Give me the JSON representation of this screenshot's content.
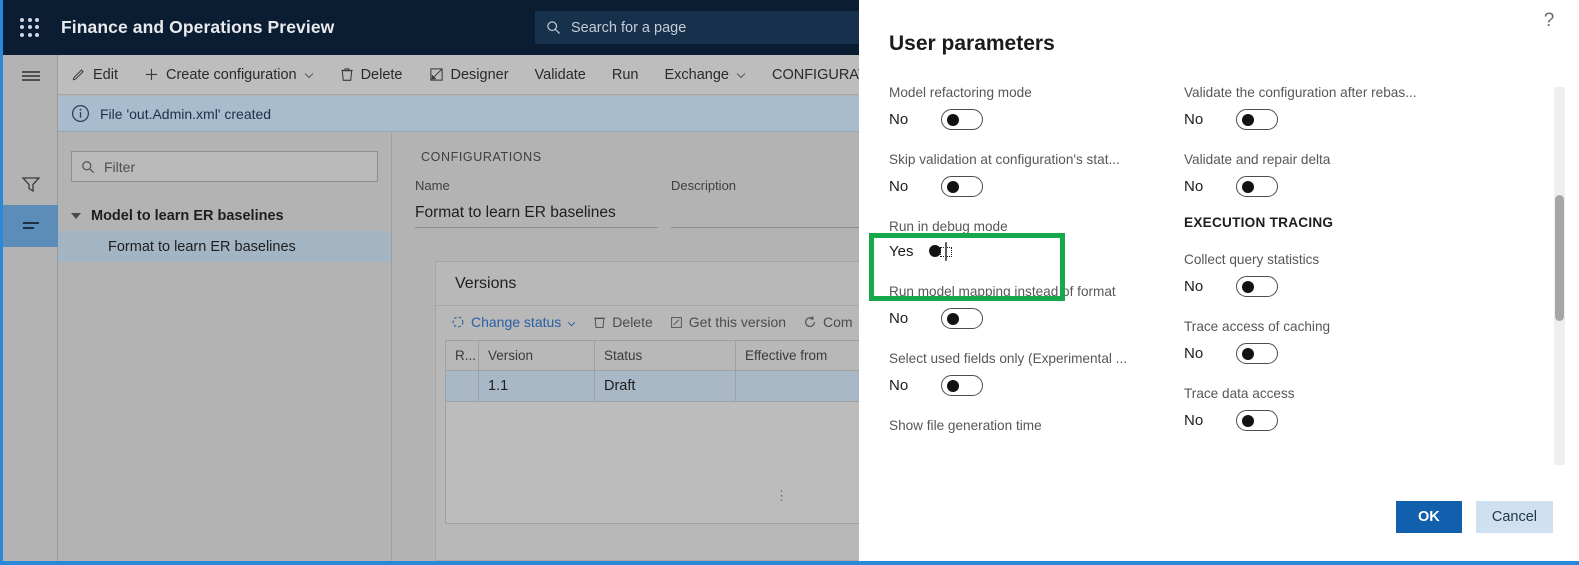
{
  "app": {
    "title": "Finance and Operations Preview",
    "waffle_icon": "app-launcher-icon",
    "search": {
      "placeholder": "Search for a page",
      "icon": "search-icon"
    },
    "toolbar": [
      {
        "label": "Edit",
        "icon": "pencil-icon",
        "caret": false
      },
      {
        "label": "Create configuration",
        "icon": "plus-icon",
        "caret": true
      },
      {
        "label": "Delete",
        "icon": "trash-icon",
        "caret": false
      },
      {
        "label": "Designer",
        "icon": "designer-icon",
        "caret": false
      },
      {
        "label": "Validate",
        "icon": "",
        "caret": false
      },
      {
        "label": "Run",
        "icon": "",
        "caret": false
      },
      {
        "label": "Exchange",
        "icon": "",
        "caret": true
      },
      {
        "label": "CONFIGURAT",
        "icon": "",
        "caret": false
      }
    ],
    "message": {
      "icon": "info-icon",
      "text": "File 'out.Admin.xml' created"
    },
    "left_rail": [
      {
        "name": "hamburger-icon",
        "selected": false
      },
      {
        "name": "filter-icon",
        "selected": false
      },
      {
        "name": "list-icon",
        "selected": true
      }
    ],
    "filter": {
      "placeholder": "Filter",
      "icon": "search-icon"
    },
    "tree": [
      {
        "label": "Model to learn ER baselines",
        "level": 0,
        "selected": false
      },
      {
        "label": "Format to learn ER baselines",
        "level": 1,
        "selected": true
      }
    ],
    "section_caption": "CONFIGURATIONS",
    "fields": [
      {
        "label": "Name",
        "value": "Format to learn ER baselines"
      },
      {
        "label": "Description",
        "value": ""
      }
    ],
    "versions": {
      "title": "Versions",
      "toolbar": [
        {
          "label": "Change status",
          "icon": "refresh-icon",
          "caret": true,
          "link": true
        },
        {
          "label": "Delete",
          "icon": "trash-icon",
          "caret": false,
          "link": false
        },
        {
          "label": "Get this version",
          "icon": "edit-box-icon",
          "caret": false,
          "link": false
        },
        {
          "label": "Com",
          "icon": "sync-icon",
          "caret": false,
          "link": false
        }
      ],
      "columns": [
        "R...",
        "Version",
        "Status",
        "Effective from"
      ],
      "rows": [
        {
          "r": "",
          "version": "1.1",
          "status": "Draft",
          "effective_from": ""
        }
      ]
    }
  },
  "dialog": {
    "title": "User parameters",
    "help_icon": "help-icon",
    "left_params": [
      {
        "label": "Model refactoring mode",
        "value": "No",
        "on": false,
        "focused": false
      },
      {
        "label": "Skip validation at configuration's stat...",
        "value": "No",
        "on": false,
        "focused": false
      },
      {
        "label": "Run in debug mode",
        "value": "Yes",
        "on": true,
        "focused": true
      },
      {
        "label": "Run model mapping instead of format",
        "value": "No",
        "on": false,
        "focused": false
      },
      {
        "label": "Select used fields only (Experimental ...",
        "value": "No",
        "on": false,
        "focused": false
      },
      {
        "label": "Show file generation time",
        "value": "",
        "on": null,
        "focused": false
      }
    ],
    "right_params": [
      {
        "label": "Validate the configuration after rebas...",
        "value": "No",
        "on": false,
        "focused": false
      },
      {
        "label": "Validate and repair delta",
        "value": "No",
        "on": false,
        "focused": false
      }
    ],
    "group_title": "EXECUTION TRACING",
    "tracing_params": [
      {
        "label": "Collect query statistics",
        "value": "No",
        "on": false,
        "focused": false
      },
      {
        "label": "Trace access of caching",
        "value": "No",
        "on": false,
        "focused": false
      },
      {
        "label": "Trace data access",
        "value": "No",
        "on": false,
        "focused": false
      }
    ],
    "ok_label": "OK",
    "cancel_label": "Cancel",
    "highlight_color": "#16a94b",
    "accent_color": "#1260ad"
  }
}
